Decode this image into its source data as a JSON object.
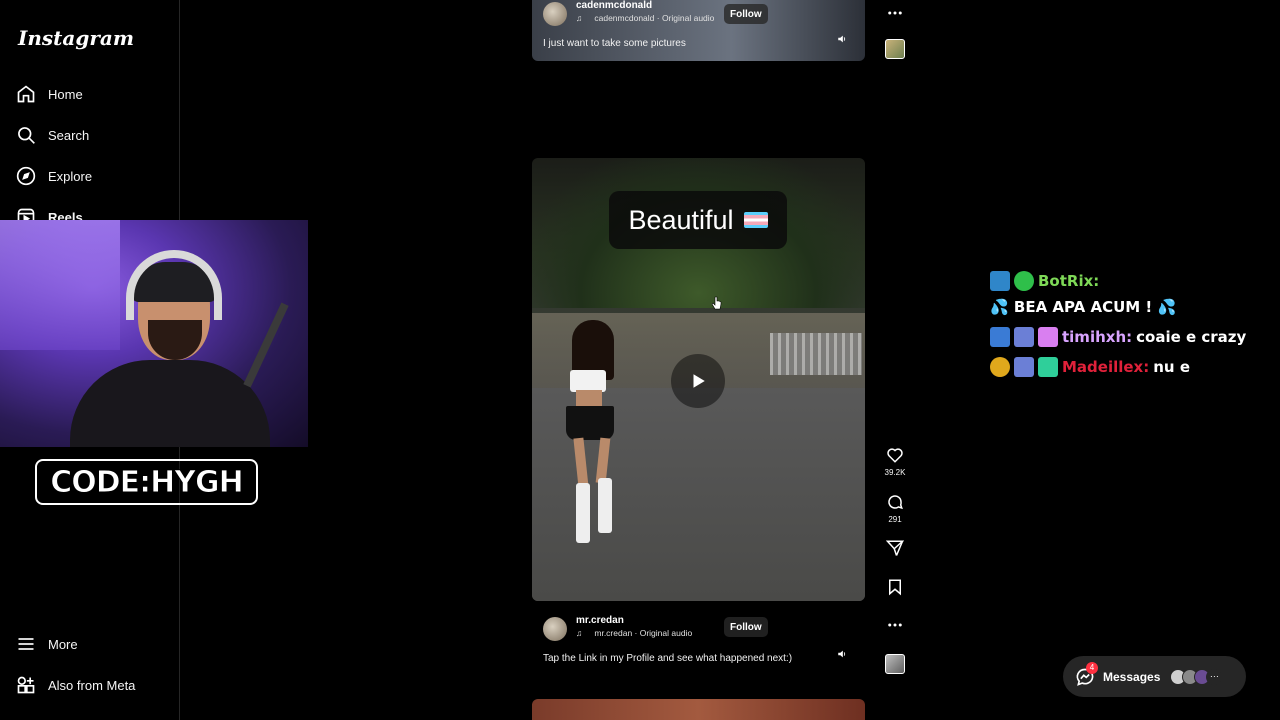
{
  "sidebar": {
    "logo": "Instagram",
    "items": [
      {
        "label": "Home",
        "icon": "home-icon"
      },
      {
        "label": "Search",
        "icon": "search-icon"
      },
      {
        "label": "Explore",
        "icon": "compass-icon"
      },
      {
        "label": "Reels",
        "icon": "reels-icon"
      },
      {
        "label": "More",
        "icon": "menu-icon"
      },
      {
        "label": "Also from Meta",
        "icon": "meta-apps-icon"
      }
    ]
  },
  "stream_overlay": {
    "code_badge": "CODE:HYGH"
  },
  "reels": {
    "top": {
      "username": "cadenmcdonald",
      "audio": "cadenmcdonald · Original audio",
      "follow": "Follow",
      "caption": "I just want to take some pictures"
    },
    "main": {
      "overlay_text": "Beautiful",
      "username": "mr.credan",
      "audio": "mr.credan · Original audio",
      "follow": "Follow",
      "caption": "Tap the Link in my Profile and see what happened next:)",
      "likes": "39.2K",
      "comments": "291"
    }
  },
  "chat": [
    {
      "user": "BotRix:",
      "user_color": "#7ed957",
      "message": "💦 BEA APA ACUM ! 💦"
    },
    {
      "user": "timihxh:",
      "user_color": "#d9a4ff",
      "message": "coaie e crazy"
    },
    {
      "user": "Madeillex:",
      "user_color": "#e0213a",
      "message": "nu e"
    }
  ],
  "messages": {
    "label": "Messages",
    "badge": "4"
  },
  "colors": {
    "background": "#000000",
    "sidebar_border": "#262626",
    "pill": "#262626",
    "badge": "#ff3040"
  }
}
